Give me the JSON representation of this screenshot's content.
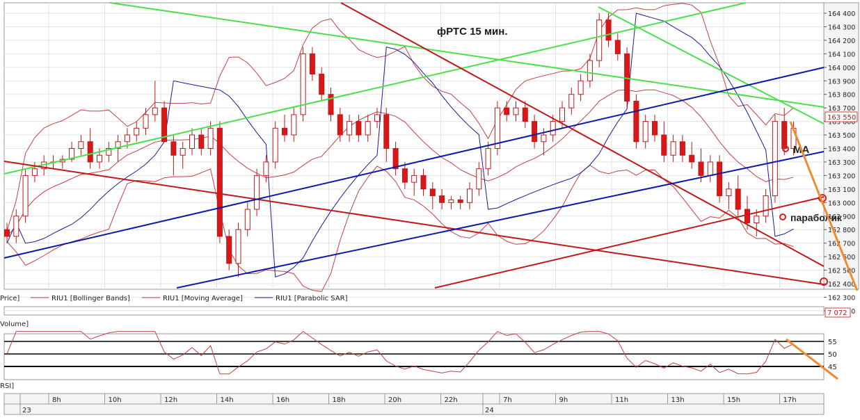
{
  "chart_data": {
    "type": "candlestick",
    "title": "фРТС   15 мин.",
    "price_axis": {
      "ticks": [
        164400,
        164300,
        164200,
        164100,
        164000,
        163900,
        163800,
        163700,
        163600,
        163500,
        163400,
        163300,
        163200,
        163100,
        163000,
        162900,
        162800,
        162700,
        162600,
        162500,
        162400,
        162300,
        162200
      ],
      "current_price": "163 550",
      "ylim": [
        162180,
        164470
      ]
    },
    "legend": {
      "price": "Price]",
      "bollinger": "RIU1 [Bollinger Bands]",
      "ma": "RIU1 [Moving Average]",
      "sar": "RIU1 [Parabolic SAR]"
    },
    "volume": {
      "label": "Volume]",
      "value": "7 072"
    },
    "rsi": {
      "label": "RSI]",
      "ticks": [
        55,
        50,
        45
      ],
      "levels": [
        55,
        50,
        45
      ]
    },
    "time_axis": {
      "labels": [
        "8h",
        "10h",
        "12h",
        "14h",
        "16h",
        "18h",
        "20h",
        "22h",
        "7h",
        "9h",
        "11h",
        "13h",
        "15h",
        "17h"
      ],
      "days": [
        "23",
        "24"
      ]
    },
    "annotations": {
      "ma": "MA",
      "sar": "параболик"
    },
    "candles": [
      [
        162800,
        162850,
        162700,
        162750
      ],
      [
        162750,
        162950,
        162700,
        162900
      ],
      [
        162900,
        163250,
        162850,
        163200
      ],
      [
        163200,
        163300,
        163150,
        163250
      ],
      [
        163250,
        163350,
        163200,
        163300
      ],
      [
        163300,
        163350,
        163250,
        163300
      ],
      [
        163300,
        163350,
        163250,
        163320
      ],
      [
        163320,
        163450,
        163300,
        163400
      ],
      [
        163400,
        163500,
        163350,
        163450
      ],
      [
        163450,
        163550,
        163250,
        163300
      ],
      [
        163300,
        163400,
        163250,
        163350
      ],
      [
        163350,
        163450,
        163300,
        163400
      ],
      [
        163400,
        163500,
        163300,
        163450
      ],
      [
        163450,
        163550,
        163400,
        163500
      ],
      [
        163500,
        163600,
        163450,
        163550
      ],
      [
        163550,
        163700,
        163500,
        163650
      ],
      [
        163650,
        163900,
        163600,
        163700
      ],
      [
        163700,
        163750,
        163450,
        163450
      ],
      [
        163450,
        163500,
        163200,
        163350
      ],
      [
        163350,
        163450,
        163250,
        163400
      ],
      [
        163400,
        163550,
        163350,
        163500
      ],
      [
        163500,
        163550,
        163350,
        163400
      ],
      [
        163400,
        163600,
        163350,
        163550
      ],
      [
        163550,
        163600,
        162700,
        162750
      ],
      [
        162750,
        162800,
        162500,
        162550
      ],
      [
        162550,
        162850,
        162450,
        162800
      ],
      [
        162800,
        163000,
        162750,
        162950
      ],
      [
        162950,
        163250,
        162900,
        163200
      ],
      [
        163200,
        163350,
        163150,
        163300
      ],
      [
        163300,
        163600,
        163250,
        163550
      ],
      [
        163550,
        163650,
        163450,
        163500
      ],
      [
        163500,
        163700,
        163450,
        163650
      ],
      [
        163650,
        164150,
        163600,
        164100
      ],
      [
        164100,
        164150,
        163900,
        163950
      ],
      [
        163950,
        164000,
        163750,
        163800
      ],
      [
        163800,
        163850,
        163600,
        163650
      ],
      [
        163650,
        163700,
        163450,
        163500
      ],
      [
        163500,
        163650,
        163450,
        163600
      ],
      [
        163600,
        163650,
        163450,
        163500
      ],
      [
        163500,
        163650,
        163450,
        163600
      ],
      [
        163600,
        163700,
        163550,
        163650
      ],
      [
        163650,
        163700,
        163300,
        163400
      ],
      [
        163400,
        163450,
        163200,
        163250
      ],
      [
        163250,
        163300,
        163100,
        163150
      ],
      [
        163150,
        163250,
        163050,
        163200
      ],
      [
        163200,
        163250,
        163050,
        163100
      ],
      [
        163100,
        163150,
        162950,
        163050
      ],
      [
        163050,
        163100,
        162950,
        163000
      ],
      [
        163000,
        163050,
        162950,
        163020
      ],
      [
        163020,
        163050,
        162950,
        163000
      ],
      [
        163000,
        163150,
        162950,
        163100
      ],
      [
        163100,
        163300,
        163050,
        163250
      ],
      [
        163250,
        163450,
        163200,
        163400
      ],
      [
        163400,
        163750,
        163350,
        163700
      ],
      [
        163700,
        163750,
        163600,
        163650
      ],
      [
        163650,
        163750,
        163600,
        163700
      ],
      [
        163700,
        163750,
        163550,
        163600
      ],
      [
        163600,
        163650,
        163400,
        163450
      ],
      [
        163450,
        163550,
        163350,
        163500
      ],
      [
        163500,
        163650,
        163450,
        163600
      ],
      [
        163600,
        163750,
        163550,
        163700
      ],
      [
        163700,
        163850,
        163650,
        163800
      ],
      [
        163800,
        163950,
        163750,
        163900
      ],
      [
        163900,
        164100,
        163850,
        164050
      ],
      [
        164050,
        164400,
        164000,
        164350
      ],
      [
        164350,
        164400,
        164150,
        164200
      ],
      [
        164200,
        164250,
        164050,
        164100
      ],
      [
        164100,
        164150,
        163700,
        163750
      ],
      [
        163750,
        163800,
        163400,
        163450
      ],
      [
        163450,
        163650,
        163400,
        163600
      ],
      [
        163600,
        163650,
        163450,
        163500
      ],
      [
        163500,
        163600,
        163300,
        163350
      ],
      [
        163350,
        163500,
        163300,
        163450
      ],
      [
        163450,
        163500,
        163300,
        163350
      ],
      [
        163350,
        163450,
        163250,
        163300
      ],
      [
        163300,
        163400,
        163150,
        163200
      ],
      [
        163200,
        163350,
        163150,
        163300
      ],
      [
        163300,
        163350,
        163000,
        163050
      ],
      [
        163050,
        163150,
        162950,
        163100
      ],
      [
        163100,
        163200,
        162900,
        162950
      ],
      [
        162950,
        163050,
        162800,
        162850
      ],
      [
        162850,
        162950,
        162750,
        162900
      ],
      [
        162900,
        163100,
        162850,
        163050
      ],
      [
        163050,
        163650,
        163000,
        163600
      ],
      [
        163600,
        163700,
        163350,
        163400
      ],
      [
        163400,
        163600,
        163350,
        163550
      ]
    ]
  }
}
